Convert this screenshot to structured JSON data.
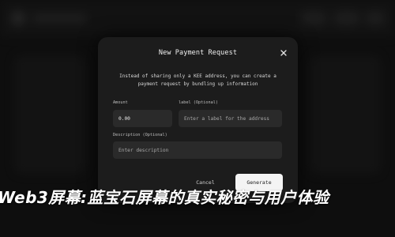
{
  "modal": {
    "title": "New Payment Request",
    "description": "Instead of sharing only a KEE address, you can create a payment request by bundling up information",
    "amount": {
      "label": "Amount",
      "value": "0.00"
    },
    "label_field": {
      "label": "label (Optional)",
      "placeholder": "Enter a label for the address"
    },
    "description_field": {
      "label": "Description (Optional)",
      "placeholder": "Enter description"
    },
    "cancel_label": "Cancel",
    "generate_label": "Generate"
  },
  "headline": "Web3屏幕:蓝宝石屏幕的真实秘密与用户体验",
  "icons": {
    "close": "close-icon"
  }
}
